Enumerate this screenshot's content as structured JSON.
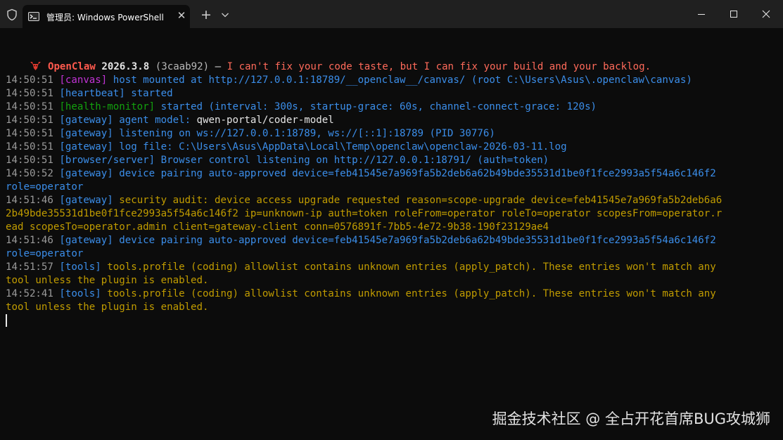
{
  "window": {
    "tab_title": "管理员: Windows PowerShell"
  },
  "colors": {
    "timestamp": "#9a9a9a",
    "tag_canvas": "#c233d6",
    "tag_heartbeat": "#3b8eea",
    "tag_health": "#13a10e",
    "tag_gateway": "#3b8eea",
    "tag_browser": "#3b8eea",
    "tag_tools": "#3b8eea",
    "info_text": "#3b8eea",
    "plain_text": "#e6e6e6",
    "warn_text": "#c19c00",
    "banner_name": "#ff5a4e",
    "banner_tagline": "#ff6a5a"
  },
  "banner": {
    "icon": "lobster-icon",
    "name": "OpenClaw",
    "version": "2026.3.8",
    "hash": "(3caab92)",
    "separator": "—",
    "tagline": "I can't fix your code taste, but I can fix your build and your backlog."
  },
  "lines": [
    [
      {
        "t": "14:50:51 ",
        "c": "timestamp"
      },
      {
        "t": "[canvas]",
        "c": "tag_canvas"
      },
      {
        "t": " host mounted at http://127.0.0.1:18789/__openclaw__/canvas/ (root C:\\Users\\Asus\\.openclaw\\canvas)",
        "c": "info_text"
      }
    ],
    [
      {
        "t": "14:50:51 ",
        "c": "timestamp"
      },
      {
        "t": "[heartbeat]",
        "c": "tag_heartbeat"
      },
      {
        "t": " started",
        "c": "info_text"
      }
    ],
    [
      {
        "t": "14:50:51 ",
        "c": "timestamp"
      },
      {
        "t": "[health-monitor]",
        "c": "tag_health"
      },
      {
        "t": " started (interval: 300s, startup-grace: 60s, channel-connect-grace: 120s)",
        "c": "info_text"
      }
    ],
    [
      {
        "t": "14:50:51 ",
        "c": "timestamp"
      },
      {
        "t": "[gateway]",
        "c": "tag_gateway"
      },
      {
        "t": " agent model: ",
        "c": "info_text"
      },
      {
        "t": "qwen-portal/coder-model",
        "c": "plain_text"
      }
    ],
    [
      {
        "t": "14:50:51 ",
        "c": "timestamp"
      },
      {
        "t": "[gateway]",
        "c": "tag_gateway"
      },
      {
        "t": " listening on ws://127.0.0.1:18789, ws://[::1]:18789 (PID 30776)",
        "c": "info_text"
      }
    ],
    [
      {
        "t": "14:50:51 ",
        "c": "timestamp"
      },
      {
        "t": "[gateway]",
        "c": "tag_gateway"
      },
      {
        "t": " log file: C:\\Users\\Asus\\AppData\\Local\\Temp\\openclaw\\openclaw-2026-03-11.log",
        "c": "info_text"
      }
    ],
    [
      {
        "t": "14:50:51 ",
        "c": "timestamp"
      },
      {
        "t": "[browser/server]",
        "c": "tag_browser"
      },
      {
        "t": " Browser control listening on http://127.0.0.1:18791/ (auth=token)",
        "c": "info_text"
      }
    ],
    [
      {
        "t": "14:50:52 ",
        "c": "timestamp"
      },
      {
        "t": "[gateway]",
        "c": "tag_gateway"
      },
      {
        "t": " device pairing auto-approved device=feb41545e7a969fa5b2deb6a62b49bde35531d1be0f1fce2993a5f54a6c146f2",
        "c": "info_text"
      }
    ],
    [
      {
        "t": "role=operator",
        "c": "info_text"
      }
    ],
    [
      {
        "t": "14:51:46 ",
        "c": "timestamp"
      },
      {
        "t": "[gateway]",
        "c": "tag_gateway"
      },
      {
        "t": " security audit: device access upgrade requested reason=scope-upgrade device=feb41545e7a969fa5b2deb6a6",
        "c": "warn_text"
      }
    ],
    [
      {
        "t": "2b49bde35531d1be0f1fce2993a5f54a6c146f2 ip=unknown-ip auth=token roleFrom=operator roleTo=operator scopesFrom=operator.r",
        "c": "warn_text"
      }
    ],
    [
      {
        "t": "ead scopesTo=operator.admin client=gateway-client conn=0576891f-7bb5-4e72-9b38-190f23129ae4",
        "c": "warn_text"
      }
    ],
    [
      {
        "t": "14:51:46 ",
        "c": "timestamp"
      },
      {
        "t": "[gateway]",
        "c": "tag_gateway"
      },
      {
        "t": " device pairing auto-approved device=feb41545e7a969fa5b2deb6a62b49bde35531d1be0f1fce2993a5f54a6c146f2",
        "c": "info_text"
      }
    ],
    [
      {
        "t": "role=operator",
        "c": "info_text"
      }
    ],
    [
      {
        "t": "14:51:57 ",
        "c": "timestamp"
      },
      {
        "t": "[tools]",
        "c": "tag_tools"
      },
      {
        "t": " tools.profile (coding) allowlist contains unknown entries (apply_patch). These entries won't match any",
        "c": "warn_text"
      }
    ],
    [
      {
        "t": "tool unless the plugin is enabled.",
        "c": "warn_text"
      }
    ],
    [
      {
        "t": "14:52:41 ",
        "c": "timestamp"
      },
      {
        "t": "[tools]",
        "c": "tag_tools"
      },
      {
        "t": " tools.profile (coding) allowlist contains unknown entries (apply_patch). These entries won't match any",
        "c": "warn_text"
      }
    ],
    [
      {
        "t": "tool unless the plugin is enabled.",
        "c": "warn_text"
      }
    ]
  ],
  "watermark": "掘金技术社区 @ 全占开花首席BUG攻城狮"
}
